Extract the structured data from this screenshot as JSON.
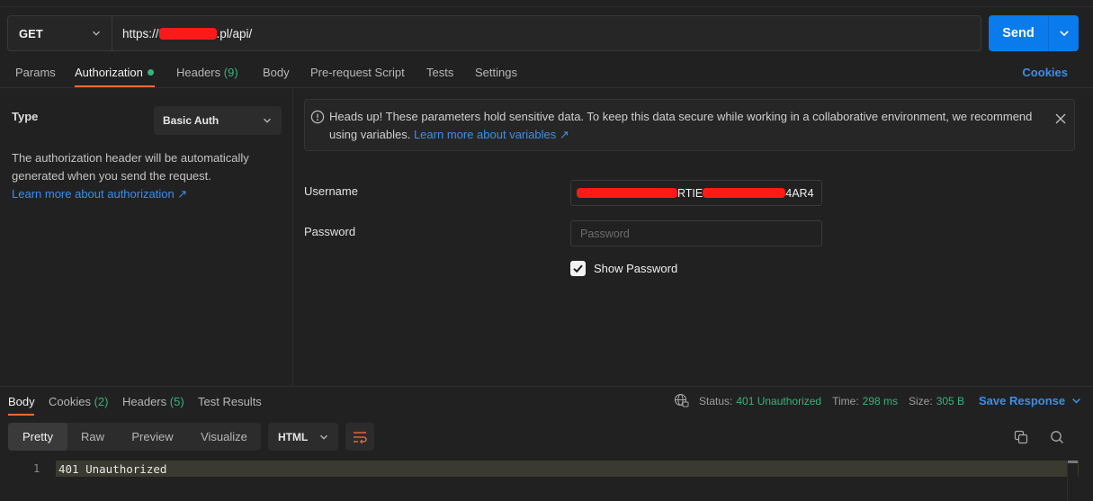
{
  "request": {
    "method": "GET",
    "url_prefix": "https://",
    "url_suffix": ".pl/api/",
    "send_label": "Send"
  },
  "req_tabs": {
    "params": "Params",
    "authorization": "Authorization",
    "headers": "Headers",
    "headers_count": "(9)",
    "body": "Body",
    "prerequest": "Pre-request Script",
    "tests": "Tests",
    "settings": "Settings",
    "cookies": "Cookies"
  },
  "auth": {
    "type_label": "Type",
    "type_value": "Basic Auth",
    "description": "The authorization header will be automatically generated when you send the request.",
    "learn_more": "Learn more about authorization ↗"
  },
  "notice": {
    "text": "Heads up! These parameters hold sensitive data. To keep this data secure while working in a collaborative environment, we recommend using variables.",
    "link": "Learn more about variables ↗"
  },
  "fields": {
    "username_label": "Username",
    "username_visible_fragment": "RTIE",
    "username_tail": "4AR4",
    "password_label": "Password",
    "password_placeholder": "Password",
    "show_password_label": "Show Password",
    "show_password_checked": true
  },
  "response": {
    "tabs": {
      "body": "Body",
      "cookies": "Cookies",
      "cookies_count": "(2)",
      "headers": "Headers",
      "headers_count": "(5)",
      "test_results": "Test Results"
    },
    "status_label": "Status:",
    "status_value": "401 Unauthorized",
    "time_label": "Time:",
    "time_value": "298 ms",
    "size_label": "Size:",
    "size_value": "305 B",
    "save_response": "Save Response",
    "views": [
      "Pretty",
      "Raw",
      "Preview",
      "Visualize"
    ],
    "format": "HTML",
    "lines": [
      {
        "num": "1",
        "text": "401 Unauthorized"
      }
    ]
  },
  "colors": {
    "accent_blue": "#097bed",
    "link_blue": "#3d8ee8",
    "success_green": "#36b37e",
    "active_orange": "#ff6c37",
    "redaction_red": "#ff1a1a"
  }
}
